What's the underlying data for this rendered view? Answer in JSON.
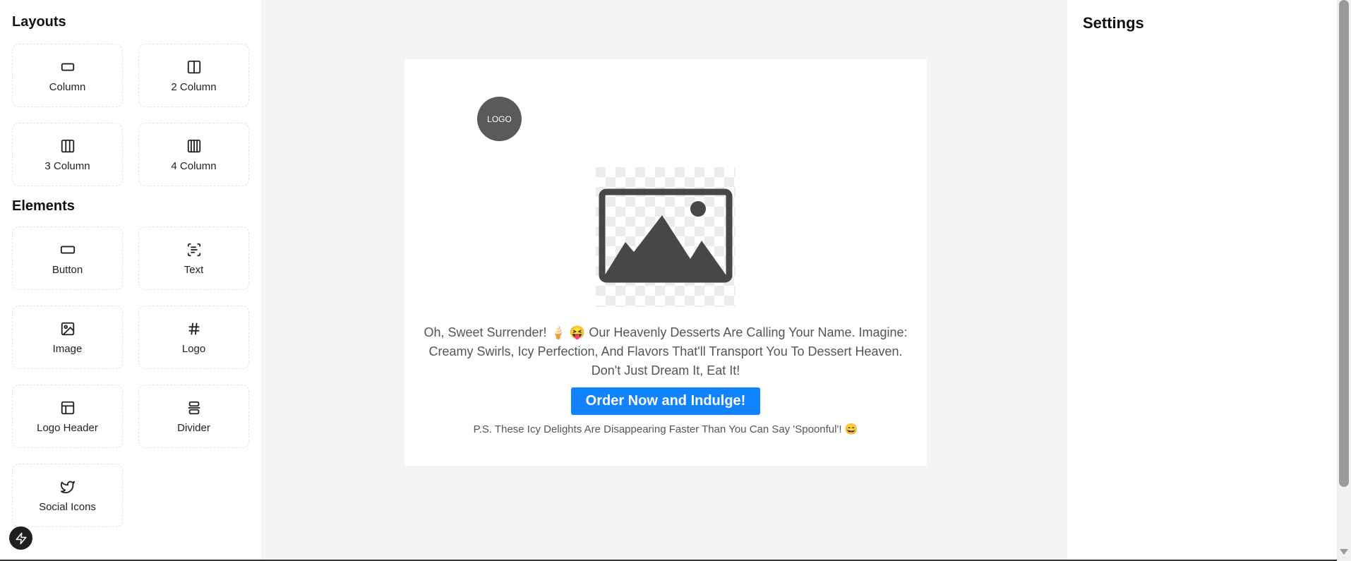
{
  "sidebar": {
    "layouts_title": "Layouts",
    "layouts": [
      {
        "label": "Column",
        "icon": "column-icon"
      },
      {
        "label": "2 Column",
        "icon": "two-column-icon"
      },
      {
        "label": "3 Column",
        "icon": "three-column-icon"
      },
      {
        "label": "4 Column",
        "icon": "four-column-icon"
      }
    ],
    "elements_title": "Elements",
    "elements": [
      {
        "label": "Button",
        "icon": "button-icon"
      },
      {
        "label": "Text",
        "icon": "text-icon"
      },
      {
        "label": "Image",
        "icon": "image-icon"
      },
      {
        "label": "Logo",
        "icon": "hash-icon"
      },
      {
        "label": "Logo Header",
        "icon": "logo-header-icon"
      },
      {
        "label": "Divider",
        "icon": "divider-icon"
      },
      {
        "label": "Social Icons",
        "icon": "twitter-icon"
      }
    ]
  },
  "email": {
    "logo_text": "LOGO",
    "body_text": "Oh, Sweet Surrender! 🍦 😝 Our Heavenly Desserts Are Calling Your Name. Imagine: Creamy Swirls, Icy Perfection, And Flavors That'll Transport You To Dessert Heaven. Don't Just Dream It, Eat It!",
    "cta_label": "Order Now and Indulge!",
    "ps_text": "P.S. These Icy Delights Are Disappearing Faster Than You Can Say 'Spoonful'! 😄"
  },
  "settings": {
    "title": "Settings"
  },
  "colors": {
    "cta": "#1183ff",
    "canvas_bg": "#f3f4f6",
    "logo_bg": "#5a5a5a"
  }
}
